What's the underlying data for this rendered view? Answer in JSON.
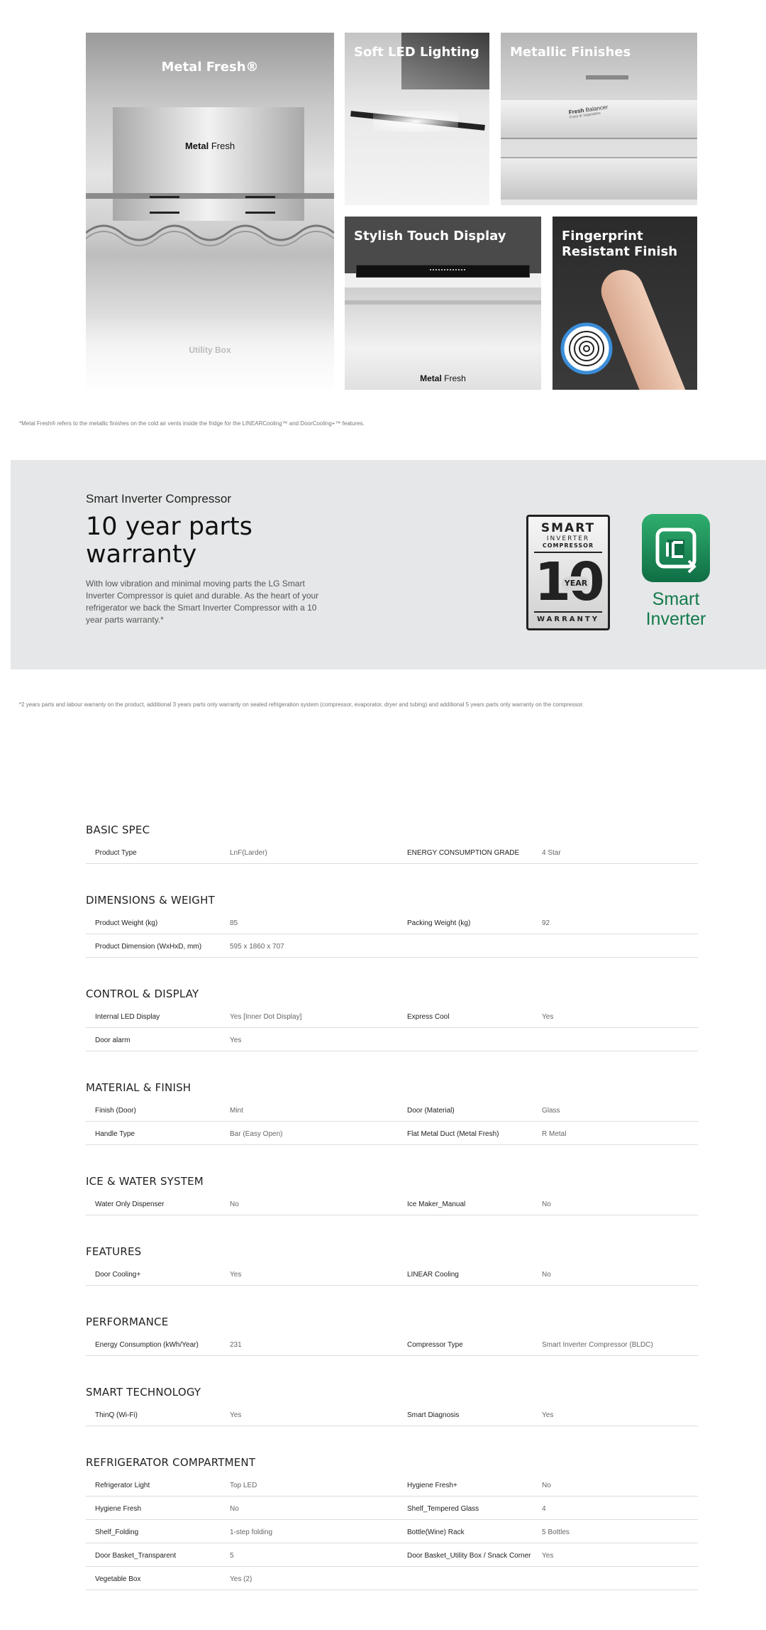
{
  "tiles": {
    "metal_fresh": {
      "title": "Metal Fresh®",
      "label_metal": "Metal",
      "label_fresh": "Fresh",
      "label_utility": "Utility Box"
    },
    "soft_led": {
      "title": "Soft LED Lighting"
    },
    "metallic": {
      "title": "Metallic Finishes",
      "panel_label_bold": "Fresh",
      "panel_label": "Balancer",
      "panel_sub": "Fruits ⊛ Vegetables"
    },
    "touch_display": {
      "title": "Stylish Touch Display",
      "label_metal": "Metal",
      "label_fresh": "Fresh"
    },
    "fingerprint": {
      "title": "Fingerprint Resistant Finish"
    }
  },
  "footnote_1": "*Metal Fresh® refers to the metallic finishes on the cold air vents inside the fridge for the LINEARCooling™ and DoorCooling+™ features.",
  "warranty": {
    "subtitle": "Smart Inverter Compressor",
    "heading_line1": "10 year parts",
    "heading_line2": "warranty",
    "body": "With low vibration and minimal moving parts the LG Smart Inverter Compressor is quiet and durable. As the heart of your refrigerator we back the Smart Inverter Compressor  with a 10 year parts warranty.*",
    "badge": {
      "smart": "SMART",
      "inverter": "INVERTER",
      "compressor": "COMPRESSOR",
      "number": "10",
      "year": "YEAR",
      "warranty": "WARRANTY"
    },
    "logo": {
      "line1": "Smart",
      "line2": "Inverter"
    }
  },
  "footnote_2": "*2 years parts and labour warranty on the product, additional 3 years parts only warranty on sealed refrigeration system (compressor, evaporator, dryer and tubing) and additional 5 years parts only warranty on the compressor.",
  "specs": [
    {
      "title": "BASIC SPEC",
      "rows": [
        [
          "Product Type",
          "LnF(Larder)",
          "ENERGY CONSUMPTION GRADE",
          "4 Star"
        ]
      ]
    },
    {
      "title": "DIMENSIONS & WEIGHT",
      "rows": [
        [
          "Product Weight (kg)",
          "85",
          "Packing Weight (kg)",
          "92"
        ],
        [
          "Product Dimension (WxHxD, mm)",
          "595 x 1860 x 707",
          "",
          ""
        ]
      ]
    },
    {
      "title": "CONTROL & DISPLAY",
      "rows": [
        [
          "Internal LED Display",
          "Yes [Inner Dot Display]",
          "Express Cool",
          "Yes"
        ],
        [
          "Door alarm",
          "Yes",
          "",
          ""
        ]
      ]
    },
    {
      "title": "MATERIAL & FINISH",
      "rows": [
        [
          "Finish (Door)",
          "Mint",
          "Door (Material)",
          "Glass"
        ],
        [
          "Handle Type",
          "Bar (Easy Open)",
          "Flat Metal Duct (Metal Fresh)",
          "R Metal"
        ]
      ]
    },
    {
      "title": "ICE & WATER SYSTEM",
      "rows": [
        [
          "Water Only Dispenser",
          "No",
          "Ice Maker_Manual",
          "No"
        ]
      ]
    },
    {
      "title": "FEATURES",
      "rows": [
        [
          "Door Cooling+",
          "Yes",
          "LINEAR Cooling",
          "No"
        ]
      ]
    },
    {
      "title": "PERFORMANCE",
      "rows": [
        [
          "Energy Consumption (kWh/Year)",
          "231",
          "Compressor Type",
          "Smart Inverter Compressor (BLDC)"
        ]
      ]
    },
    {
      "title": "SMART TECHNOLOGY",
      "rows": [
        [
          "ThinQ (Wi-Fi)",
          "Yes",
          "Smart Diagnosis",
          "Yes"
        ]
      ]
    },
    {
      "title": "REFRIGERATOR COMPARTMENT",
      "rows": [
        [
          "Refrigerator Light",
          "Top LED",
          "Hygiene Fresh+",
          "No"
        ],
        [
          "Hygiene Fresh",
          "No",
          "Shelf_Tempered Glass",
          "4"
        ],
        [
          "Shelf_Folding",
          "1-step folding",
          "Bottle(Wine) Rack",
          "5 Bottles"
        ],
        [
          "Door Basket_Transparent",
          "5",
          "Door Basket_Utility Box / Snack Corner",
          "Yes"
        ],
        [
          "Vegetable Box",
          "Yes (2)",
          "",
          ""
        ]
      ]
    }
  ]
}
